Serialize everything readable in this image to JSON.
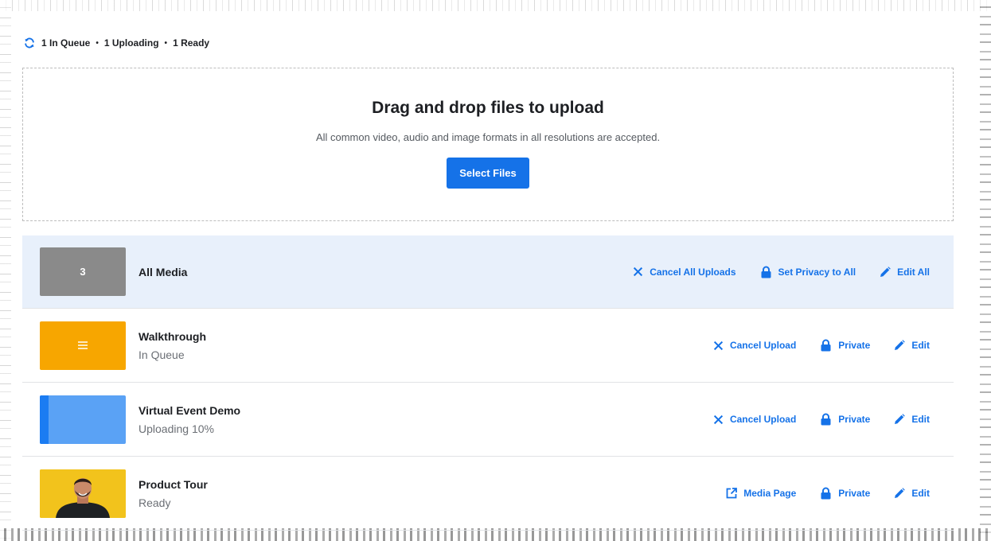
{
  "status": {
    "in_queue": "1 In Queue",
    "uploading": "1 Uploading",
    "ready": "1 Ready",
    "separator": "•"
  },
  "dropzone": {
    "title": "Drag and drop files to upload",
    "subtitle": "All common video, audio and image formats in all resolutions are accepted.",
    "button": "Select Files"
  },
  "all_media": {
    "count": "3",
    "name": "All Media",
    "cancel_all": "Cancel All Uploads",
    "privacy_all": "Set Privacy to All",
    "edit_all": "Edit All"
  },
  "items": [
    {
      "name": "Walkthrough",
      "status": "In Queue",
      "primary_action": "Cancel Upload",
      "privacy": "Private",
      "edit": "Edit"
    },
    {
      "name": "Virtual Event Demo",
      "status": "Uploading 10%",
      "progress": 0.1,
      "primary_action": "Cancel Upload",
      "privacy": "Private",
      "edit": "Edit"
    },
    {
      "name": "Product Tour",
      "status": "Ready",
      "primary_action": "Media Page",
      "privacy": "Private",
      "edit": "Edit"
    }
  ],
  "colors": {
    "accent": "#1572e8",
    "header_bg": "#e8f0fb",
    "queue_thumb": "#f7a600",
    "upload_fill": "#1b7cf2",
    "upload_bg": "#5aa2f5"
  }
}
